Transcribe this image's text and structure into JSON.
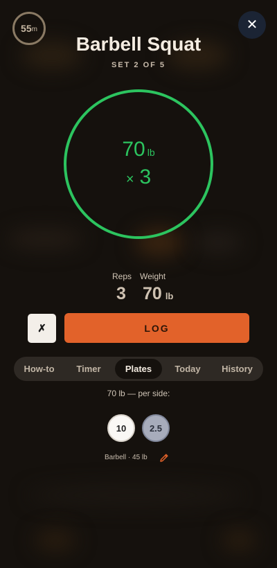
{
  "rest_timer": {
    "value": "55",
    "unit": "m"
  },
  "close_symbol": "✕",
  "exercise": {
    "title": "Barbell Squat",
    "set_label": "SET 2 OF 5"
  },
  "target": {
    "weight": "70",
    "unit": "lb",
    "times": "×",
    "reps": "3"
  },
  "stats": {
    "reps_label": "Reps",
    "reps_value": "3",
    "weight_label": "Weight",
    "weight_value": "70",
    "weight_unit": "lb"
  },
  "actions": {
    "cancel_symbol": "✗",
    "log_label": "LOG"
  },
  "tabs": [
    {
      "label": "How-to"
    },
    {
      "label": "Timer"
    },
    {
      "label": "Plates",
      "active": true
    },
    {
      "label": "Today"
    },
    {
      "label": "History"
    }
  ],
  "plates": {
    "per_side_label": "70 lb — per side:",
    "items": [
      {
        "value": "10"
      },
      {
        "value": "2.5"
      }
    ],
    "barbell_label": "Barbell · 45 lb",
    "edit_icon": "pencil-icon"
  },
  "colors": {
    "accent_green": "#2cc45f",
    "log_orange": "#e2622a",
    "background": "#15110d"
  }
}
